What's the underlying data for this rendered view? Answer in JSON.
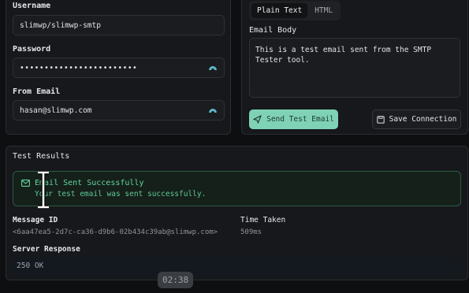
{
  "form": {
    "username_label": "Username",
    "username_value": "slimwp/slimwp-smtp",
    "password_label": "Password",
    "password_value": "••••••••••••••••••••••••",
    "from_email_label": "From Email",
    "from_email_value": "hasan@slimwp.com"
  },
  "body_tabs": {
    "plain_text": "Plain Text",
    "html": "HTML",
    "active": "Plain Text"
  },
  "email_body": {
    "label": "Email Body",
    "value": "This is a test email sent from the SMTP Tester tool."
  },
  "actions": {
    "send_label": "Send Test Email",
    "save_label": "Save Connection"
  },
  "results": {
    "title": "Test Results",
    "success_title": "Email Sent Successfully",
    "success_message": "Your test email was sent successfully.",
    "message_id_label": "Message ID",
    "message_id_value": "<6aa47ea5-2d7c-ca36-d9b6-02b434c39ab@slimwp.com>",
    "time_taken_label": "Time Taken",
    "time_taken_value": "509ms",
    "server_response_label": "Server Response",
    "server_response_value": "250 OK"
  },
  "overlay": {
    "timestamp": "02:38"
  },
  "colors": {
    "accent": "#7fd2b6",
    "success": "#63d49f",
    "background": "#0e0f11"
  },
  "icons": [
    "eye-icon",
    "send-icon",
    "save-icon",
    "mail-icon",
    "text-cursor-icon"
  ]
}
